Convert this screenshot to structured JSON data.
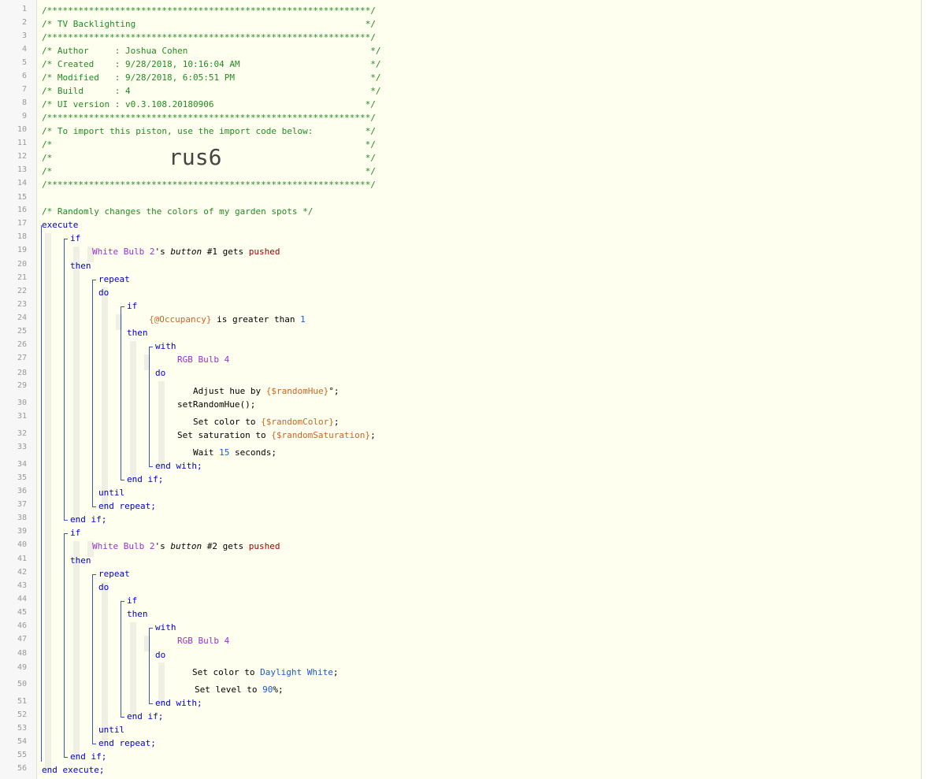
{
  "header": {
    "border": "/**************************************************************/",
    "title_row": "/* TV Backlighting                                            */",
    "author_row": "/* Author     : Joshua Cohen                                   */",
    "created_row": "/* Created    : 9/28/2018, 10:16:04 AM                         */",
    "modified_row": "/* Modified   : 9/28/2018, 6:05:51 PM                          */",
    "build_row": "/* Build      : 4                                              */",
    "ui_row": "/* UI version : v0.3.108.20180906                             */",
    "import_row": "/* To import this piston, use the import code below:          */",
    "blank_row": "/*                                                            */",
    "import_code": "rus6"
  },
  "script": {
    "description": "/* Randomly changes the colors of my garden spots */",
    "kw_execute": "execute",
    "kw_if": "if",
    "kw_then": "then",
    "kw_repeat": "repeat",
    "kw_do": "do",
    "kw_with": "with",
    "kw_until": "until",
    "end_with": "end with;",
    "end_if": "end if;",
    "end_repeat": "end repeat;",
    "end_execute": "end execute;",
    "device_white": "White Bulb 2",
    "device_rgb": "RGB Bulb 4",
    "possessive": "'s",
    "attr_button": "button",
    "btn1": "#1",
    "btn2": "#2",
    "gets": "gets",
    "pushed": "pushed",
    "occupancy_var": "{@Occupancy}",
    "greater_than": "is greater than",
    "occupancy_value": "1",
    "adjust_hue": "Adjust hue by",
    "random_hue_var": "{$randomHue}",
    "degree": "°;",
    "set_random_hue": "setRandomHue();",
    "set_color": "Set color to",
    "random_color_var": "{$randomColor}",
    "semicolon": ";",
    "set_saturation": "Set saturation to",
    "random_saturation_var": "{$randomSaturation}",
    "wait": "Wait",
    "wait_value": "15",
    "seconds": "seconds;",
    "daylight_white": "Daylight White",
    "set_level": "Set level to",
    "level_value": "90",
    "percent": "%;"
  },
  "line_numbers": [
    "1",
    "2",
    "3",
    "4",
    "5",
    "6",
    "7",
    "8",
    "9",
    "10",
    "11",
    "12",
    "13",
    "14",
    "15",
    "16",
    "17",
    "18",
    "19",
    "20",
    "21",
    "22",
    "23",
    "24",
    "25",
    "26",
    "27",
    "28",
    "29",
    "30",
    "31",
    "32",
    "33",
    "34",
    "35",
    "36",
    "37",
    "38",
    "39",
    "40",
    "41",
    "42",
    "43",
    "44",
    "45",
    "46",
    "47",
    "48",
    "49",
    "50",
    "51",
    "52",
    "53",
    "54",
    "55",
    "56"
  ]
}
